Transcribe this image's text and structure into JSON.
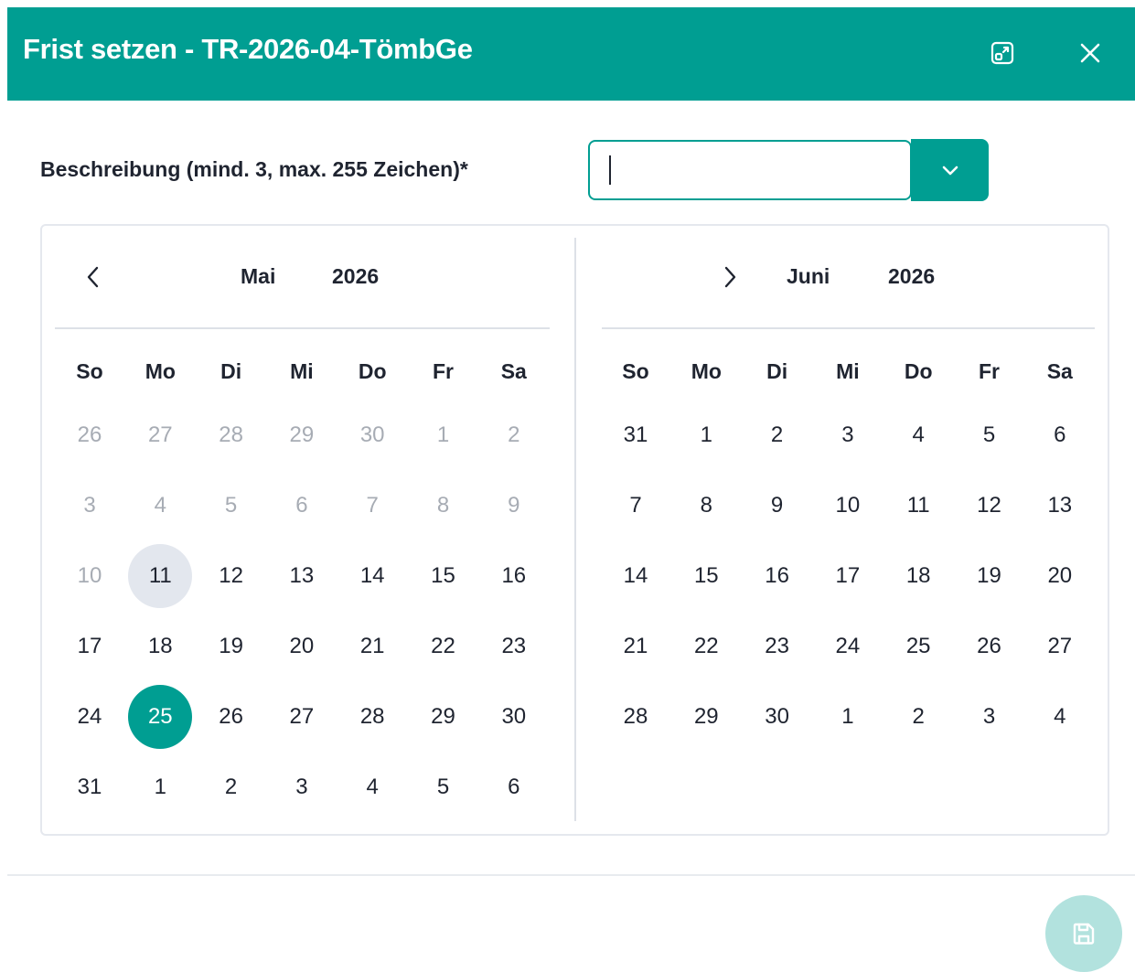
{
  "dialog": {
    "title": "Frist setzen - TR-2026-04-TömbGe",
    "icons": {
      "expand": "expand-window-icon",
      "close": "close-icon"
    },
    "accent_color": "#009e92"
  },
  "description": {
    "label": "Beschreibung (mind. 3, max. 255 Zeichen)*",
    "value": "",
    "dropdown_icon": "chevron-down-icon"
  },
  "calendar": {
    "weekdays": [
      "So",
      "Mo",
      "Di",
      "Mi",
      "Do",
      "Fr",
      "Sa"
    ],
    "months": [
      {
        "month": "Mai",
        "year": "2026",
        "nav": "chevron-left-icon",
        "weeks": [
          [
            "26",
            "27",
            "28",
            "29",
            "30",
            "1",
            "2"
          ],
          [
            "3",
            "4",
            "5",
            "6",
            "7",
            "8",
            "9"
          ],
          [
            "10",
            "11",
            "12",
            "13",
            "14",
            "15",
            "16"
          ],
          [
            "17",
            "18",
            "19",
            "20",
            "21",
            "22",
            "23"
          ],
          [
            "24",
            "25",
            "26",
            "27",
            "28",
            "29",
            "30"
          ],
          [
            "31",
            "1",
            "2",
            "3",
            "4",
            "5",
            "6"
          ]
        ],
        "muted": [
          [
            0,
            0
          ],
          [
            0,
            1
          ],
          [
            0,
            2
          ],
          [
            0,
            3
          ],
          [
            0,
            4
          ],
          [
            0,
            5
          ],
          [
            0,
            6
          ],
          [
            1,
            0
          ],
          [
            1,
            1
          ],
          [
            1,
            2
          ],
          [
            1,
            3
          ],
          [
            1,
            4
          ],
          [
            1,
            5
          ],
          [
            1,
            6
          ],
          [
            2,
            0
          ]
        ],
        "today": [
          2,
          1
        ],
        "selected": [
          4,
          1
        ]
      },
      {
        "month": "Juni",
        "year": "2026",
        "nav": "chevron-right-icon",
        "weeks": [
          [
            "31",
            "1",
            "2",
            "3",
            "4",
            "5",
            "6"
          ],
          [
            "7",
            "8",
            "9",
            "10",
            "11",
            "12",
            "13"
          ],
          [
            "14",
            "15",
            "16",
            "17",
            "18",
            "19",
            "20"
          ],
          [
            "21",
            "22",
            "23",
            "24",
            "25",
            "26",
            "27"
          ],
          [
            "28",
            "29",
            "30",
            "1",
            "2",
            "3",
            "4"
          ]
        ],
        "muted": [],
        "today": null,
        "selected": null
      }
    ]
  },
  "footer": {
    "save_icon": "save-icon"
  }
}
